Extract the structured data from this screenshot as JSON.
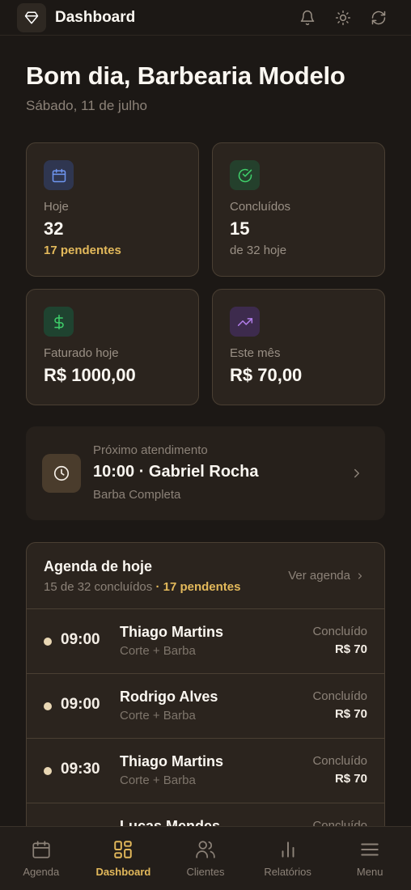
{
  "app": {
    "title": "Dashboard"
  },
  "greeting": {
    "title": "Bom dia, Barbearia Modelo",
    "date": "Sábado, 11 de julho"
  },
  "stats": [
    {
      "label": "Hoje",
      "value": "32",
      "sub": "17 pendentes",
      "icon": "calendar-icon",
      "color": "#e3b95b"
    },
    {
      "label": "Concluídos",
      "value": "15",
      "sub": "de 32 hoje",
      "icon": "check-circle-icon",
      "color": "#9a9085"
    },
    {
      "label": "Faturado hoje",
      "value": "R$ 1000,00",
      "icon": "dollar-icon"
    },
    {
      "label": "Este mês",
      "value": "R$ 70,00",
      "icon": "trending-up-icon"
    }
  ],
  "next_appointment": {
    "label": "Próximo atendimento",
    "title": "10:00 · Gabriel Rocha",
    "service": "Barba Completa"
  },
  "agenda": {
    "title": "Agenda de hoje",
    "summary": "15 de 32 concluídos",
    "pending": "· 17 pendentes",
    "link": "Ver agenda",
    "rows": [
      {
        "time": "09:00",
        "client": "Thiago Martins",
        "service": "Corte + Barba",
        "status": "Concluído",
        "price": "R$ 70"
      },
      {
        "time": "09:00",
        "client": "Rodrigo Alves",
        "service": "Corte + Barba",
        "status": "Concluído",
        "price": "R$ 70"
      },
      {
        "time": "09:30",
        "client": "Thiago Martins",
        "service": "Corte + Barba",
        "status": "Concluído",
        "price": "R$ 70"
      },
      {
        "time": "",
        "client": "Lucas Mendes",
        "service": "",
        "status": "Concluído",
        "price": ""
      }
    ]
  },
  "nav": [
    {
      "label": "Agenda",
      "icon": "calendar-icon"
    },
    {
      "label": "Dashboard",
      "icon": "grid-icon",
      "active": true
    },
    {
      "label": "Clientes",
      "icon": "users-icon"
    },
    {
      "label": "Relatórios",
      "icon": "bar-chart-icon"
    },
    {
      "label": "Menu",
      "icon": "menu-icon"
    }
  ],
  "colors": {
    "accent": "#e3b95b",
    "background": "#1c1815",
    "card": "#2b241e"
  }
}
